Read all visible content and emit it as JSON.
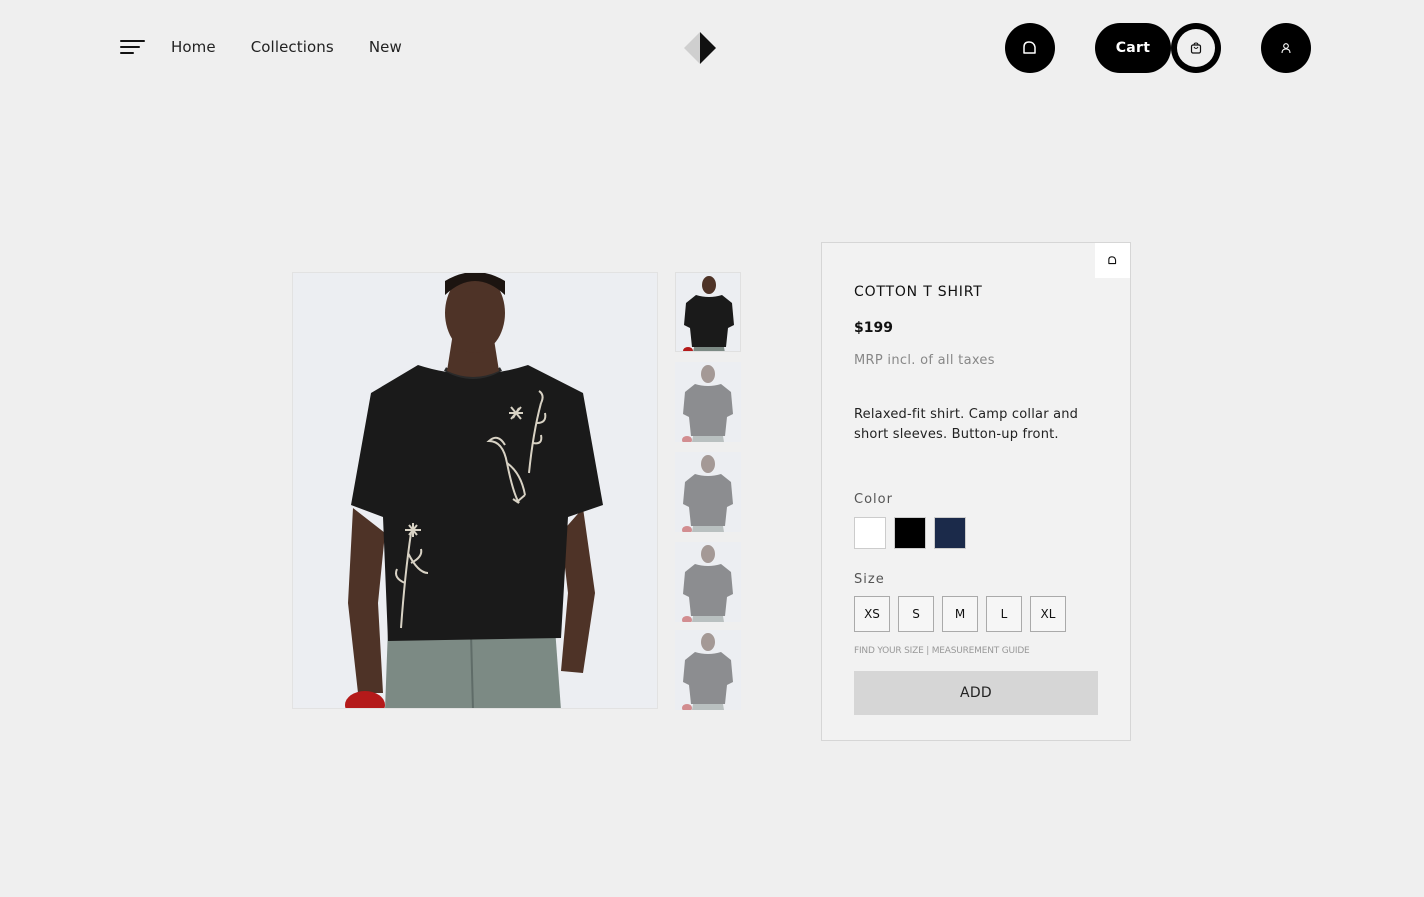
{
  "header": {
    "nav": {
      "home": "Home",
      "collections": "Collections",
      "new": "New"
    },
    "cart_label": "Cart"
  },
  "product": {
    "title": "COTTON T SHIRT",
    "price": "$199",
    "tax_note": "MRP incl. of all taxes",
    "description": "Relaxed-fit shirt. Camp collar and short sleeves. Button-up front.",
    "color_label": "Color",
    "colors": [
      "#ffffff",
      "#000000",
      "#1b2a4a"
    ],
    "size_label": "Size",
    "sizes": [
      "XS",
      "S",
      "M",
      "L",
      "XL"
    ],
    "size_guide": "FIND YOUR SIZE | MEASUREMENT GUIDE",
    "add_label": "ADD"
  },
  "icons": {
    "menu": "hamburger-menu-icon",
    "wishlist": "heart-icon",
    "cart": "shopping-bag-icon",
    "user": "user-icon"
  }
}
